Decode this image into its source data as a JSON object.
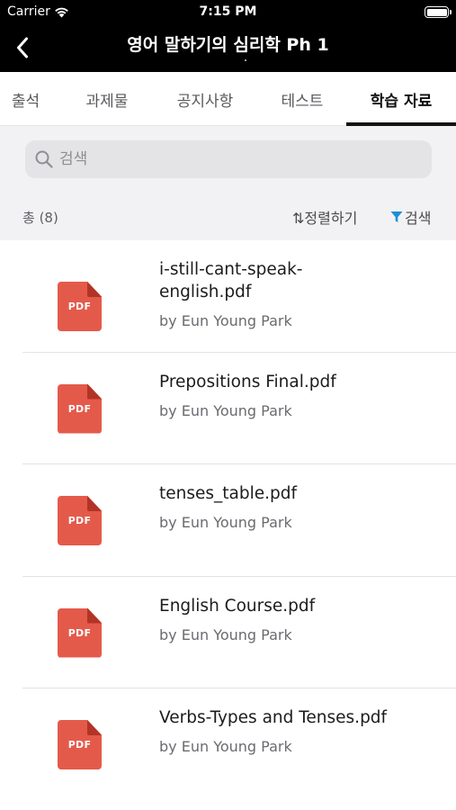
{
  "status_bar": {
    "carrier": "Carrier",
    "time": "7:15 PM",
    "battery_level": 1.0
  },
  "header": {
    "title": "영어 말하기의 심리학 Ph 1",
    "back_icon": "chevron-left-icon"
  },
  "tabs": [
    {
      "label": "출석",
      "active": false
    },
    {
      "label": "과제물",
      "active": false
    },
    {
      "label": "공지사항",
      "active": false
    },
    {
      "label": "테스트",
      "active": false
    },
    {
      "label": "학습 자료",
      "active": true
    }
  ],
  "search": {
    "placeholder": "검색",
    "value": ""
  },
  "list_meta": {
    "total": "총 (8)",
    "sort_label": "⇅정렬하기",
    "filter_label": "검색"
  },
  "files": [
    {
      "name": "i-still-cant-speak-english.pdf",
      "name_lines": [
        "i-still-cant-speak-",
        "english.pdf"
      ],
      "author": "by Eun Young Park",
      "type_label": "PDF"
    },
    {
      "name": "Prepositions Final.pdf",
      "name_lines": [
        "Prepositions Final.pdf"
      ],
      "author": "by Eun Young Park",
      "type_label": "PDF"
    },
    {
      "name": "tenses_table.pdf",
      "name_lines": [
        "tenses_table.pdf"
      ],
      "author": "by Eun Young Park",
      "type_label": "PDF"
    },
    {
      "name": "English Course.pdf",
      "name_lines": [
        "English Course.pdf"
      ],
      "author": "by Eun Young Park",
      "type_label": "PDF"
    },
    {
      "name": "Verbs-Types and Tenses.pdf",
      "name_lines": [
        "Verbs-Types and Tenses.pdf"
      ],
      "author": "by Eun Young Park",
      "type_label": "PDF"
    }
  ],
  "colors": {
    "header_bg": "#000000",
    "pdf_icon": "#e45a4a",
    "filter_accent": "#1e8fd6",
    "active_tab_underline": "#111111"
  }
}
